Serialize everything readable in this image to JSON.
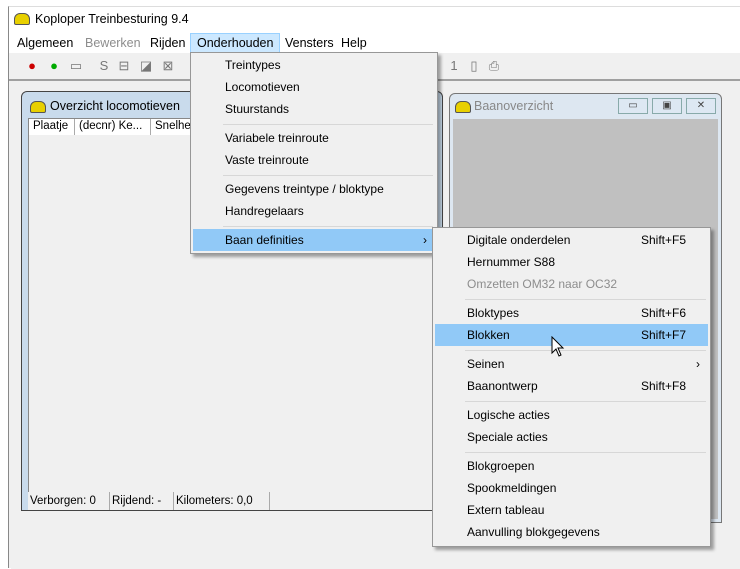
{
  "app": {
    "title": "Koploper Treinbesturing 9.4"
  },
  "menubar": [
    "Algemeen",
    "Bewerken",
    "Rijden",
    "Onderhouden",
    "Vensters",
    "Help"
  ],
  "loco_window": {
    "title": "Overzicht locomotieven",
    "columns": [
      "Plaatje",
      "(decnr) Ke...",
      "Snelhe"
    ],
    "status": [
      "Verborgen: 0",
      "Rijdend: -",
      "Kilometers:  0,0"
    ]
  },
  "baan_window": {
    "title": "Baanoverzicht"
  },
  "onderhouden_menu": [
    {
      "label": "Treintypes"
    },
    {
      "label": "Locomotieven"
    },
    {
      "label": "Stuurstands"
    },
    {
      "label": "Variabele treinroute"
    },
    {
      "label": "Vaste treinroute"
    },
    {
      "label": "Gegevens treintype / bloktype"
    },
    {
      "label": "Handregelaars"
    },
    {
      "label": "Baan definities",
      "arrow": "›"
    }
  ],
  "baan_submenu": [
    {
      "label": "Digitale onderdelen",
      "shortcut": "Shift+F5"
    },
    {
      "label": "Hernummer S88"
    },
    {
      "label": "Omzetten OM32 naar OC32"
    },
    {
      "label": "Bloktypes",
      "shortcut": "Shift+F6"
    },
    {
      "label": "Blokken",
      "shortcut": "Shift+F7"
    },
    {
      "label": "Seinen",
      "arrow": "›"
    },
    {
      "label": "Baanontwerp",
      "shortcut": "Shift+F8"
    },
    {
      "label": "Logische acties"
    },
    {
      "label": "Speciale acties"
    },
    {
      "label": "Blokgroepen"
    },
    {
      "label": "Spookmeldingen"
    },
    {
      "label": "Extern tableau"
    },
    {
      "label": "Aanvulling blokgegevens"
    }
  ]
}
